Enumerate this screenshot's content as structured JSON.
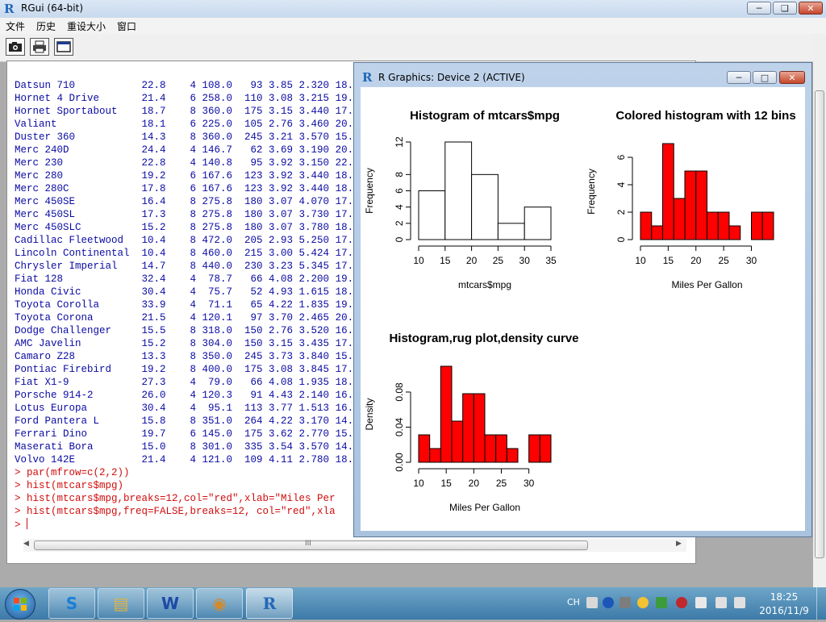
{
  "app": {
    "title": "RGui (64-bit)"
  },
  "menu": [
    "文件",
    "历史",
    "重设大小",
    "窗口"
  ],
  "toolbar": {
    "buttons": [
      "camera-icon",
      "printer-icon",
      "window-icon"
    ]
  },
  "console": {
    "rows": [
      {
        "name": "Datsun 710",
        "mpg": "22.8",
        "cyl": "4",
        "disp": "108.0",
        "hp": "93",
        "drat": "3.85",
        "wt": "2.320",
        "qsec": "18."
      },
      {
        "name": "Hornet 4 Drive",
        "mpg": "21.4",
        "cyl": "6",
        "disp": "258.0",
        "hp": "110",
        "drat": "3.08",
        "wt": "3.215",
        "qsec": "19."
      },
      {
        "name": "Hornet Sportabout",
        "mpg": "18.7",
        "cyl": "8",
        "disp": "360.0",
        "hp": "175",
        "drat": "3.15",
        "wt": "3.440",
        "qsec": "17."
      },
      {
        "name": "Valiant",
        "mpg": "18.1",
        "cyl": "6",
        "disp": "225.0",
        "hp": "105",
        "drat": "2.76",
        "wt": "3.460",
        "qsec": "20."
      },
      {
        "name": "Duster 360",
        "mpg": "14.3",
        "cyl": "8",
        "disp": "360.0",
        "hp": "245",
        "drat": "3.21",
        "wt": "3.570",
        "qsec": "15."
      },
      {
        "name": "Merc 240D",
        "mpg": "24.4",
        "cyl": "4",
        "disp": "146.7",
        "hp": "62",
        "drat": "3.69",
        "wt": "3.190",
        "qsec": "20."
      },
      {
        "name": "Merc 230",
        "mpg": "22.8",
        "cyl": "4",
        "disp": "140.8",
        "hp": "95",
        "drat": "3.92",
        "wt": "3.150",
        "qsec": "22."
      },
      {
        "name": "Merc 280",
        "mpg": "19.2",
        "cyl": "6",
        "disp": "167.6",
        "hp": "123",
        "drat": "3.92",
        "wt": "3.440",
        "qsec": "18."
      },
      {
        "name": "Merc 280C",
        "mpg": "17.8",
        "cyl": "6",
        "disp": "167.6",
        "hp": "123",
        "drat": "3.92",
        "wt": "3.440",
        "qsec": "18."
      },
      {
        "name": "Merc 450SE",
        "mpg": "16.4",
        "cyl": "8",
        "disp": "275.8",
        "hp": "180",
        "drat": "3.07",
        "wt": "4.070",
        "qsec": "17."
      },
      {
        "name": "Merc 450SL",
        "mpg": "17.3",
        "cyl": "8",
        "disp": "275.8",
        "hp": "180",
        "drat": "3.07",
        "wt": "3.730",
        "qsec": "17."
      },
      {
        "name": "Merc 450SLC",
        "mpg": "15.2",
        "cyl": "8",
        "disp": "275.8",
        "hp": "180",
        "drat": "3.07",
        "wt": "3.780",
        "qsec": "18."
      },
      {
        "name": "Cadillac Fleetwood",
        "mpg": "10.4",
        "cyl": "8",
        "disp": "472.0",
        "hp": "205",
        "drat": "2.93",
        "wt": "5.250",
        "qsec": "17."
      },
      {
        "name": "Lincoln Continental",
        "mpg": "10.4",
        "cyl": "8",
        "disp": "460.0",
        "hp": "215",
        "drat": "3.00",
        "wt": "5.424",
        "qsec": "17."
      },
      {
        "name": "Chrysler Imperial",
        "mpg": "14.7",
        "cyl": "8",
        "disp": "440.0",
        "hp": "230",
        "drat": "3.23",
        "wt": "5.345",
        "qsec": "17."
      },
      {
        "name": "Fiat 128",
        "mpg": "32.4",
        "cyl": "4",
        "disp": "78.7",
        "hp": "66",
        "drat": "4.08",
        "wt": "2.200",
        "qsec": "19."
      },
      {
        "name": "Honda Civic",
        "mpg": "30.4",
        "cyl": "4",
        "disp": "75.7",
        "hp": "52",
        "drat": "4.93",
        "wt": "1.615",
        "qsec": "18."
      },
      {
        "name": "Toyota Corolla",
        "mpg": "33.9",
        "cyl": "4",
        "disp": "71.1",
        "hp": "65",
        "drat": "4.22",
        "wt": "1.835",
        "qsec": "19."
      },
      {
        "name": "Toyota Corona",
        "mpg": "21.5",
        "cyl": "4",
        "disp": "120.1",
        "hp": "97",
        "drat": "3.70",
        "wt": "2.465",
        "qsec": "20."
      },
      {
        "name": "Dodge Challenger",
        "mpg": "15.5",
        "cyl": "8",
        "disp": "318.0",
        "hp": "150",
        "drat": "2.76",
        "wt": "3.520",
        "qsec": "16."
      },
      {
        "name": "AMC Javelin",
        "mpg": "15.2",
        "cyl": "8",
        "disp": "304.0",
        "hp": "150",
        "drat": "3.15",
        "wt": "3.435",
        "qsec": "17."
      },
      {
        "name": "Camaro Z28",
        "mpg": "13.3",
        "cyl": "8",
        "disp": "350.0",
        "hp": "245",
        "drat": "3.73",
        "wt": "3.840",
        "qsec": "15."
      },
      {
        "name": "Pontiac Firebird",
        "mpg": "19.2",
        "cyl": "8",
        "disp": "400.0",
        "hp": "175",
        "drat": "3.08",
        "wt": "3.845",
        "qsec": "17."
      },
      {
        "name": "Fiat X1-9",
        "mpg": "27.3",
        "cyl": "4",
        "disp": "79.0",
        "hp": "66",
        "drat": "4.08",
        "wt": "1.935",
        "qsec": "18."
      },
      {
        "name": "Porsche 914-2",
        "mpg": "26.0",
        "cyl": "4",
        "disp": "120.3",
        "hp": "91",
        "drat": "4.43",
        "wt": "2.140",
        "qsec": "16."
      },
      {
        "name": "Lotus Europa",
        "mpg": "30.4",
        "cyl": "4",
        "disp": "95.1",
        "hp": "113",
        "drat": "3.77",
        "wt": "1.513",
        "qsec": "16."
      },
      {
        "name": "Ford Pantera L",
        "mpg": "15.8",
        "cyl": "8",
        "disp": "351.0",
        "hp": "264",
        "drat": "4.22",
        "wt": "3.170",
        "qsec": "14."
      },
      {
        "name": "Ferrari Dino",
        "mpg": "19.7",
        "cyl": "6",
        "disp": "145.0",
        "hp": "175",
        "drat": "3.62",
        "wt": "2.770",
        "qsec": "15."
      },
      {
        "name": "Maserati Bora",
        "mpg": "15.0",
        "cyl": "8",
        "disp": "301.0",
        "hp": "335",
        "drat": "3.54",
        "wt": "3.570",
        "qsec": "14."
      },
      {
        "name": "Volvo 142E",
        "mpg": "21.4",
        "cyl": "4",
        "disp": "121.0",
        "hp": "109",
        "drat": "4.11",
        "wt": "2.780",
        "qsec": "18."
      }
    ],
    "commands": [
      "> par(mfrow=c(2,2))",
      "> hist(mtcars$mpg)",
      "> hist(mtcars$mpg,breaks=12,col=\"red\",xlab=\"Miles Per",
      "> hist(mtcars$mpg,freq=FALSE,breaks=12, col=\"red\",xla"
    ],
    "prompt": "> ",
    "hscroll_grip": "III"
  },
  "graphics_window": {
    "title": "R Graphics: Device 2 (ACTIVE)"
  },
  "chart_data": [
    {
      "type": "bar",
      "title": "Histogram of mtcars$mpg",
      "xlabel": "mtcars$mpg",
      "ylabel": "Frequency",
      "bin_edges": [
        10,
        15,
        20,
        25,
        30,
        35
      ],
      "values": [
        6,
        12,
        8,
        2,
        4
      ],
      "xticks": [
        10,
        15,
        20,
        25,
        30,
        35
      ],
      "yticks": [
        0,
        2,
        4,
        6,
        8,
        12
      ],
      "xlim": [
        10,
        35
      ],
      "ylim": [
        0,
        12
      ],
      "fill": "#ffffff"
    },
    {
      "type": "bar",
      "title": "Colored histogram with 12 bins",
      "xlabel": "Miles Per Gallon",
      "ylabel": "Frequency",
      "bin_edges": [
        10,
        12,
        14,
        16,
        18,
        20,
        22,
        24,
        26,
        28,
        30,
        32,
        34
      ],
      "values": [
        2,
        1,
        7,
        3,
        5,
        5,
        2,
        2,
        1,
        0,
        2,
        2
      ],
      "xticks": [
        10,
        15,
        20,
        25,
        30
      ],
      "yticks": [
        0,
        2,
        4,
        6
      ],
      "xlim": [
        10,
        34
      ],
      "ylim": [
        0,
        7
      ],
      "fill": "#ff0000"
    },
    {
      "type": "bar",
      "title": "Histogram,rug plot,density curve",
      "xlabel": "Miles Per Gallon",
      "ylabel": "Density",
      "bin_edges": [
        10,
        12,
        14,
        16,
        18,
        20,
        22,
        24,
        26,
        28,
        30,
        32,
        34
      ],
      "values": [
        0.03125,
        0.015625,
        0.109375,
        0.046875,
        0.078125,
        0.078125,
        0.03125,
        0.03125,
        0.015625,
        0,
        0.03125,
        0.03125
      ],
      "xticks": [
        10,
        15,
        20,
        25,
        30
      ],
      "yticks": [
        "0.00",
        "0.04",
        "0.08"
      ],
      "xlim": [
        10,
        34
      ],
      "ylim": [
        0,
        0.109375
      ],
      "fill": "#ff0000"
    }
  ],
  "taskbar": {
    "apps": [
      "sogou-icon",
      "file-explorer-icon",
      "word-icon",
      "paint-icon",
      "r-icon"
    ],
    "tray_lang": "CH",
    "clock_time": "18:25",
    "clock_date": "2016/11/9"
  },
  "colors": {
    "console_text": "#0a0aa4",
    "console_cmd": "#d10c0c",
    "bar_red": "#ff0000"
  }
}
